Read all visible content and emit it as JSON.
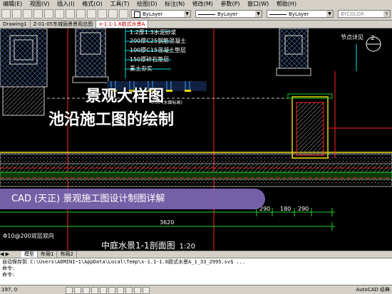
{
  "menu": [
    "(E)",
    "(V)",
    "(I)",
    "(O)",
    "(T)",
    "(D)",
    "(N)",
    "(M)",
    "(P)",
    "(W)",
    "(H)"
  ],
  "menu_labels": [
    "编辑(E)",
    "视图(V)",
    "插入(I)",
    "格式(O)",
    "工具(T)",
    "绘图(D)",
    "标注(N)",
    "修改(M)",
    "参数(P)",
    "窗口(W)",
    "帮助(H)"
  ],
  "toolbar": {
    "color_combo": "ByLayer",
    "linetype_combo": "ByLayer",
    "lineweight_combo": "ByLayer",
    "plotstyle_combo": "BYCOLOR"
  },
  "doc_tabs": [
    "Drawing1",
    "Z-01-05东城丽景景观总图",
    "x-1.1-1.6欧式水景A"
  ],
  "active_doc_tab": "x-1.1-1.6欧式水景A",
  "drawing_notes": [
    "1.2厚1:3水泥砂浆",
    "200厚C25钢筋混凝土",
    "100厚C15混凝土垫层",
    "150厚碎石垫层",
    "素土夯实"
  ],
  "dims": [
    "290",
    "180",
    "290",
    "3620"
  ],
  "note_small": "0.00 (水面标高)",
  "note_bottom_left": "Φ10@200双层双向",
  "tag_right": "节点详见",
  "tag_num": "2",
  "overlay_titles": {
    "line1": "景观大样图",
    "line2": "池沿施工图的绘制"
  },
  "banner": "CAD (天正) 景观施工图设计制图详解",
  "section_title": "中庭水景1-1剖面图",
  "scale": "1:20",
  "layout_tabs": [
    "模型",
    "布局1",
    "布局2"
  ],
  "active_layout_tab": "模型",
  "command_lines": [
    "自动保存到 C:\\Users\\ADMINI~1\\AppData\\Local\\Temp\\x-1.1-1.6欧式水景A_1_33_2995.sv$ ...",
    "命令:",
    "命令:"
  ],
  "status": {
    "coords": "197, 0",
    "brand": "AutoCAD 经典"
  },
  "colors": {
    "cad_bg": "#000000",
    "banner": "#7e68b4",
    "cyan": "#00e0e0",
    "yellow": "#e8d800",
    "red": "#ff2020",
    "green": "#20d020"
  }
}
